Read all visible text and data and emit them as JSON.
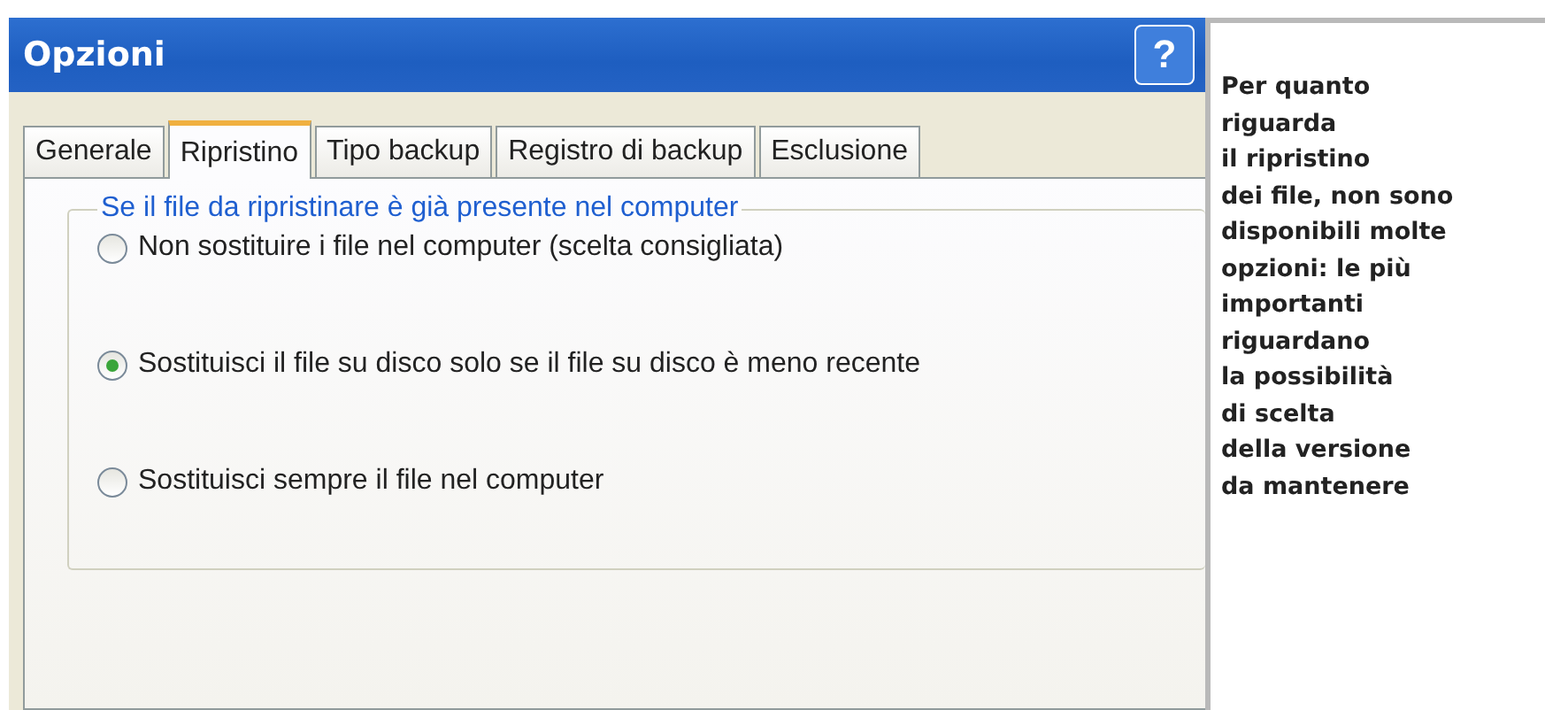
{
  "window": {
    "title": "Opzioni",
    "help_button": "?"
  },
  "tabs": [
    {
      "label": "Generale",
      "selected": false
    },
    {
      "label": "Ripristino",
      "selected": true
    },
    {
      "label": "Tipo backup",
      "selected": false
    },
    {
      "label": "Registro di backup",
      "selected": false
    },
    {
      "label": "Esclusione",
      "selected": false
    }
  ],
  "group": {
    "title": "Se il file da ripristinare è già presente nel computer",
    "options": [
      {
        "label": "Non sostituire i file nel computer (scelta consigliata)",
        "selected": false
      },
      {
        "label": "Sostituisci il file su disco solo se il file su disco è meno recente",
        "selected": true
      },
      {
        "label": "Sostituisci sempre il file nel computer",
        "selected": false
      }
    ]
  },
  "caption": [
    "Per quanto",
    "riguarda",
    "il ripristino",
    "dei file, non sono",
    "disponibili molte",
    "opzioni: le più",
    "importanti",
    "riguardano",
    "la possibilità",
    "di scelta",
    "della versione",
    "da mantenere"
  ]
}
